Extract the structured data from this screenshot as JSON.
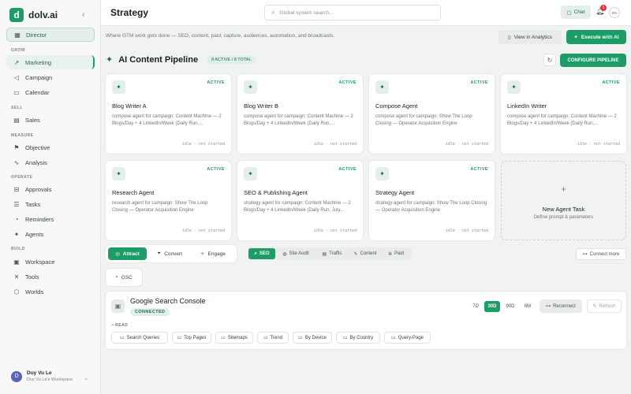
{
  "brand": {
    "logo_letter": "d",
    "name": "dolv.ai",
    "collapse_icon": "chevron-left-icon"
  },
  "sidebar": {
    "top_item": {
      "label": "Director",
      "icon": "grid-icon"
    },
    "sections": [
      {
        "title": "GROW",
        "items": [
          {
            "label": "Marketing",
            "icon": "trend-icon"
          },
          {
            "label": "Campaign",
            "icon": "megaphone-icon"
          },
          {
            "label": "Calendar",
            "icon": "calendar-icon"
          }
        ]
      },
      {
        "title": "SELL",
        "items": [
          {
            "label": "Sales",
            "icon": "chart-icon"
          }
        ]
      },
      {
        "title": "MEASURE",
        "items": [
          {
            "label": "Objective",
            "icon": "flag-icon"
          },
          {
            "label": "Analysis",
            "icon": "analysis-icon"
          }
        ]
      },
      {
        "title": "OPERATE",
        "items": [
          {
            "label": "Approvals",
            "icon": "approvals-icon"
          },
          {
            "label": "Tasks",
            "icon": "tasks-icon"
          },
          {
            "label": "Reminders",
            "icon": "bell-icon"
          },
          {
            "label": "Agents",
            "icon": "agents-icon"
          }
        ]
      },
      {
        "title": "BUILD",
        "items": [
          {
            "label": "Workspace",
            "icon": "workspace-icon"
          },
          {
            "label": "Tools",
            "icon": "tools-icon"
          },
          {
            "label": "Worlds",
            "icon": "cube-icon"
          }
        ]
      }
    ],
    "user": {
      "initial": "D",
      "name": "Duy Vu Le",
      "workspace": "Duy Vu Le's Workspace"
    }
  },
  "header": {
    "title": "Strategy",
    "search_placeholder": "Global system search...",
    "chat_label": "Chat",
    "notification_count": "1",
    "progress_label": "0%"
  },
  "main": {
    "tagline": "Where GTM work gets done — SEO, content, paid, capture, audiences, automation, and broadcasts.",
    "view_analytics": "View in Analytics",
    "execute_ai": "Execute with AI",
    "pipeline_title": "AI Content Pipeline",
    "pipeline_badge": "8 ACTIVE / 8 TOTAL",
    "configure_label": "CONFIGURE PIPELINE",
    "agents": [
      {
        "name": "Blog Writer A",
        "status": "ACTIVE",
        "desc": "compose agent for campaign: Content Machine — 2 Blogs/Day + 4 LinkedIn/Week (Daily Run,...",
        "foot": "idle · not started"
      },
      {
        "name": "Blog Writer B",
        "status": "ACTIVE",
        "desc": "compose agent for campaign: Content Machine — 2 Blogs/Day + 4 LinkedIn/Week (Daily Run,...",
        "foot": "idle · not started"
      },
      {
        "name": "Compose Agent",
        "status": "ACTIVE",
        "desc": "compose agent for campaign: Show The Loop Closing — Operator Acquisition Engine",
        "foot": "idle · not started"
      },
      {
        "name": "LinkedIn Writer",
        "status": "ACTIVE",
        "desc": "compose agent for campaign: Content Machine — 2 Blogs/Day + 4 LinkedIn/Week (Daily Run,...",
        "foot": "idle · not started"
      },
      {
        "name": "Research Agent",
        "status": "ACTIVE",
        "desc": "research agent for campaign: Show The Loop Closing — Operator Acquisition Engine",
        "foot": "idle · not started"
      },
      {
        "name": "SEO & Publishing Agent",
        "status": "ACTIVE",
        "desc": "strategy agent for campaign: Content Machine — 2 Blogs/Day + 4 LinkedIn/Week (Daily Run, July...",
        "foot": "idle · not started"
      },
      {
        "name": "Strategy Agent",
        "status": "ACTIVE",
        "desc": "strategy agent for campaign: Show The Loop Closing — Operator Acquisition Engine",
        "foot": "idle · not started"
      }
    ],
    "new_task": {
      "title": "New Agent Task",
      "sub": "Define prompt & parameters"
    },
    "tabs": [
      "Attract",
      "Convert",
      "Engage"
    ],
    "subtabs": [
      "SEO",
      "Site Audit",
      "Traffic",
      "Content",
      "Paid"
    ],
    "connect_more": "Connect more",
    "gsc_label": "GSC",
    "gsc_panel": {
      "title": "Google Search Console",
      "status": "CONNECTED",
      "ranges": [
        "7D",
        "30D",
        "90D",
        "6M"
      ],
      "active_range": "30D",
      "reconnect": "Reconnect",
      "refresh": "Refresh",
      "read_label": "READ",
      "queries": [
        "Search Queries",
        "Top Pages",
        "Sitemaps",
        "Trend",
        "By Device",
        "By Country",
        "Query-Page"
      ]
    }
  },
  "colors": {
    "accent": "#1e9c68",
    "accent_soft": "#e3efe8",
    "badge": "#d9363e"
  }
}
